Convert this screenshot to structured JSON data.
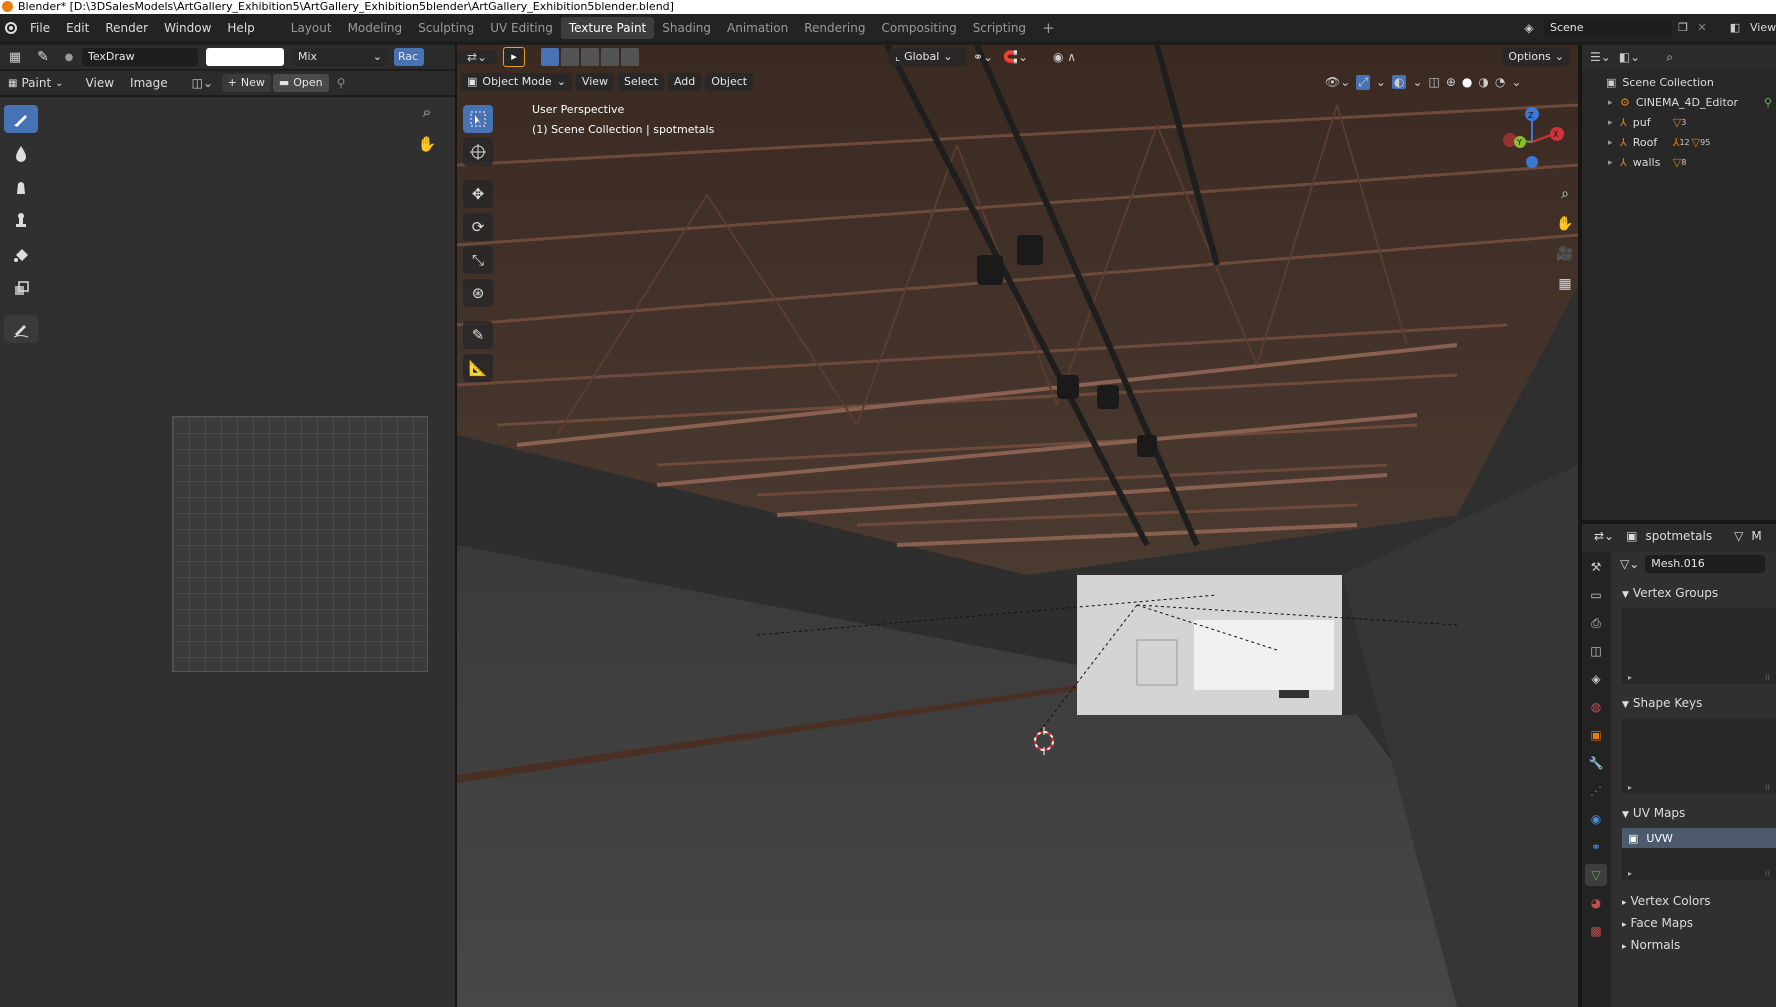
{
  "window": {
    "title": "Blender* [D:\\3DSalesModels\\ArtGallery_Exhibition5\\ArtGallery_Exhibition5blender\\ArtGallery_Exhibition5blender.blend]"
  },
  "menu": {
    "file": "File",
    "edit": "Edit",
    "render": "Render",
    "window": "Window",
    "help": "Help"
  },
  "workspaces": [
    "Layout",
    "Modeling",
    "Sculpting",
    "UV Editing",
    "Texture Paint",
    "Shading",
    "Animation",
    "Rendering",
    "Compositing",
    "Scripting"
  ],
  "active_workspace": "Texture Paint",
  "scene": {
    "name": "Scene",
    "view_label": "View"
  },
  "tool_header": {
    "brush_name": "TexDraw",
    "blend_mode": "Mix",
    "radius_label": "Rac"
  },
  "image_editor": {
    "mode": "Paint",
    "view": "View",
    "image": "Image",
    "new_label": "New",
    "open_label": "Open"
  },
  "viewport": {
    "mode": "Object Mode",
    "menus": [
      "View",
      "Select",
      "Add",
      "Object"
    ],
    "orientation": "Global",
    "options": "Options",
    "perspective_label": "User Perspective",
    "collection_label": "(1) Scene Collection | spotmetals"
  },
  "outliner": {
    "root": "Scene Collection",
    "items": [
      {
        "name": "CINEMA_4D_Editor"
      },
      {
        "name": "puf",
        "badge": "3"
      },
      {
        "name": "Roof",
        "badge": "12",
        "badge2": "95"
      },
      {
        "name": "walls",
        "badge": "8"
      }
    ]
  },
  "properties": {
    "object_name": "spotmetals",
    "truncated_label": "M",
    "mesh_name": "Mesh.016",
    "sections": {
      "vertex_groups": "Vertex Groups",
      "shape_keys": "Shape Keys",
      "uv_maps": "UV Maps",
      "vertex_colors": "Vertex Colors",
      "face_maps": "Face Maps",
      "normals": "Normals"
    },
    "uv_map_item": "UVW"
  },
  "colors": {
    "accent": "#4772b3",
    "active_tab": "#3d3d3d",
    "orange": "#e87d0d"
  }
}
